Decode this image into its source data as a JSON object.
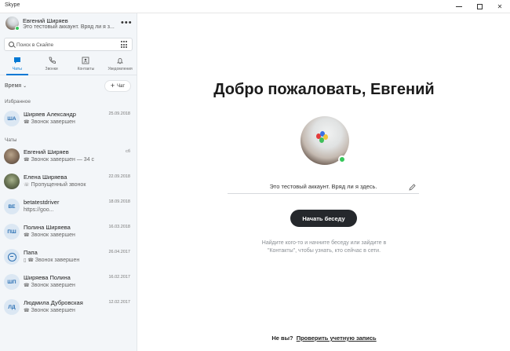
{
  "window": {
    "title": "Skype"
  },
  "profile": {
    "name": "Евгений Ширяев",
    "mood": "Это тестовый аккаунт. Вряд ли я з...",
    "status_color": "#35c759"
  },
  "search": {
    "placeholder": "Поиск в Скайпе"
  },
  "tabs": [
    {
      "label": "Чаты",
      "icon": "chat-icon",
      "active": true
    },
    {
      "label": "Звонки",
      "icon": "phone-icon",
      "active": false
    },
    {
      "label": "Контакты",
      "icon": "contacts-icon",
      "active": false
    },
    {
      "label": "Уведомления",
      "icon": "bell-icon",
      "active": false
    }
  ],
  "sort": {
    "label": "Время"
  },
  "new_chat": {
    "label": "Чат"
  },
  "sections": {
    "favorites": "Избранное",
    "chats": "Чаты"
  },
  "favorites": [
    {
      "initials": "ША",
      "name": "Ширяев Александр",
      "date": "25.09.2018",
      "status": "Звонок завершен"
    }
  ],
  "chats": [
    {
      "initials": "",
      "name": "Евгений Ширяев",
      "date": "сб",
      "status": "Звонок завершен — 34 с"
    },
    {
      "initials": "",
      "name": "Елена Ширяева",
      "date": "22.09.2018",
      "status": "Пропущенный звонок"
    },
    {
      "initials": "BE",
      "name": "betatestdriver",
      "date": "18.09.2018",
      "status": "https://goo..."
    },
    {
      "initials": "ПШ",
      "name": "Полина Ширяева",
      "date": "16.03.2018",
      "status": "Звонок завершен"
    },
    {
      "initials": "",
      "name": "Папа",
      "date": "26.04.2017",
      "status": "Звонок завершен"
    },
    {
      "initials": "ШП",
      "name": "Ширяева Полина",
      "date": "16.02.2017",
      "status": "Звонок завершен"
    },
    {
      "initials": "ЛД",
      "name": "Людмила Дубровская",
      "date": "12.02.2017",
      "status": "Звонок завершен"
    }
  ],
  "main": {
    "welcome": "Добро пожаловать, Евгений",
    "mood": "Это тестовый аккаунт. Вряд ли я здесь.",
    "start_button": "Начать беседу",
    "hint_line1": "Найдите кого-то и начните беседу или зайдите в",
    "hint_line2": "\"Контакты\", чтобы узнать, кто сейчас в сети.",
    "footer_question": "Не вы?",
    "footer_link": "Проверить учетную запись"
  },
  "colors": {
    "accent": "#0078d4",
    "online": "#35c759",
    "button_dark": "#25282c"
  }
}
